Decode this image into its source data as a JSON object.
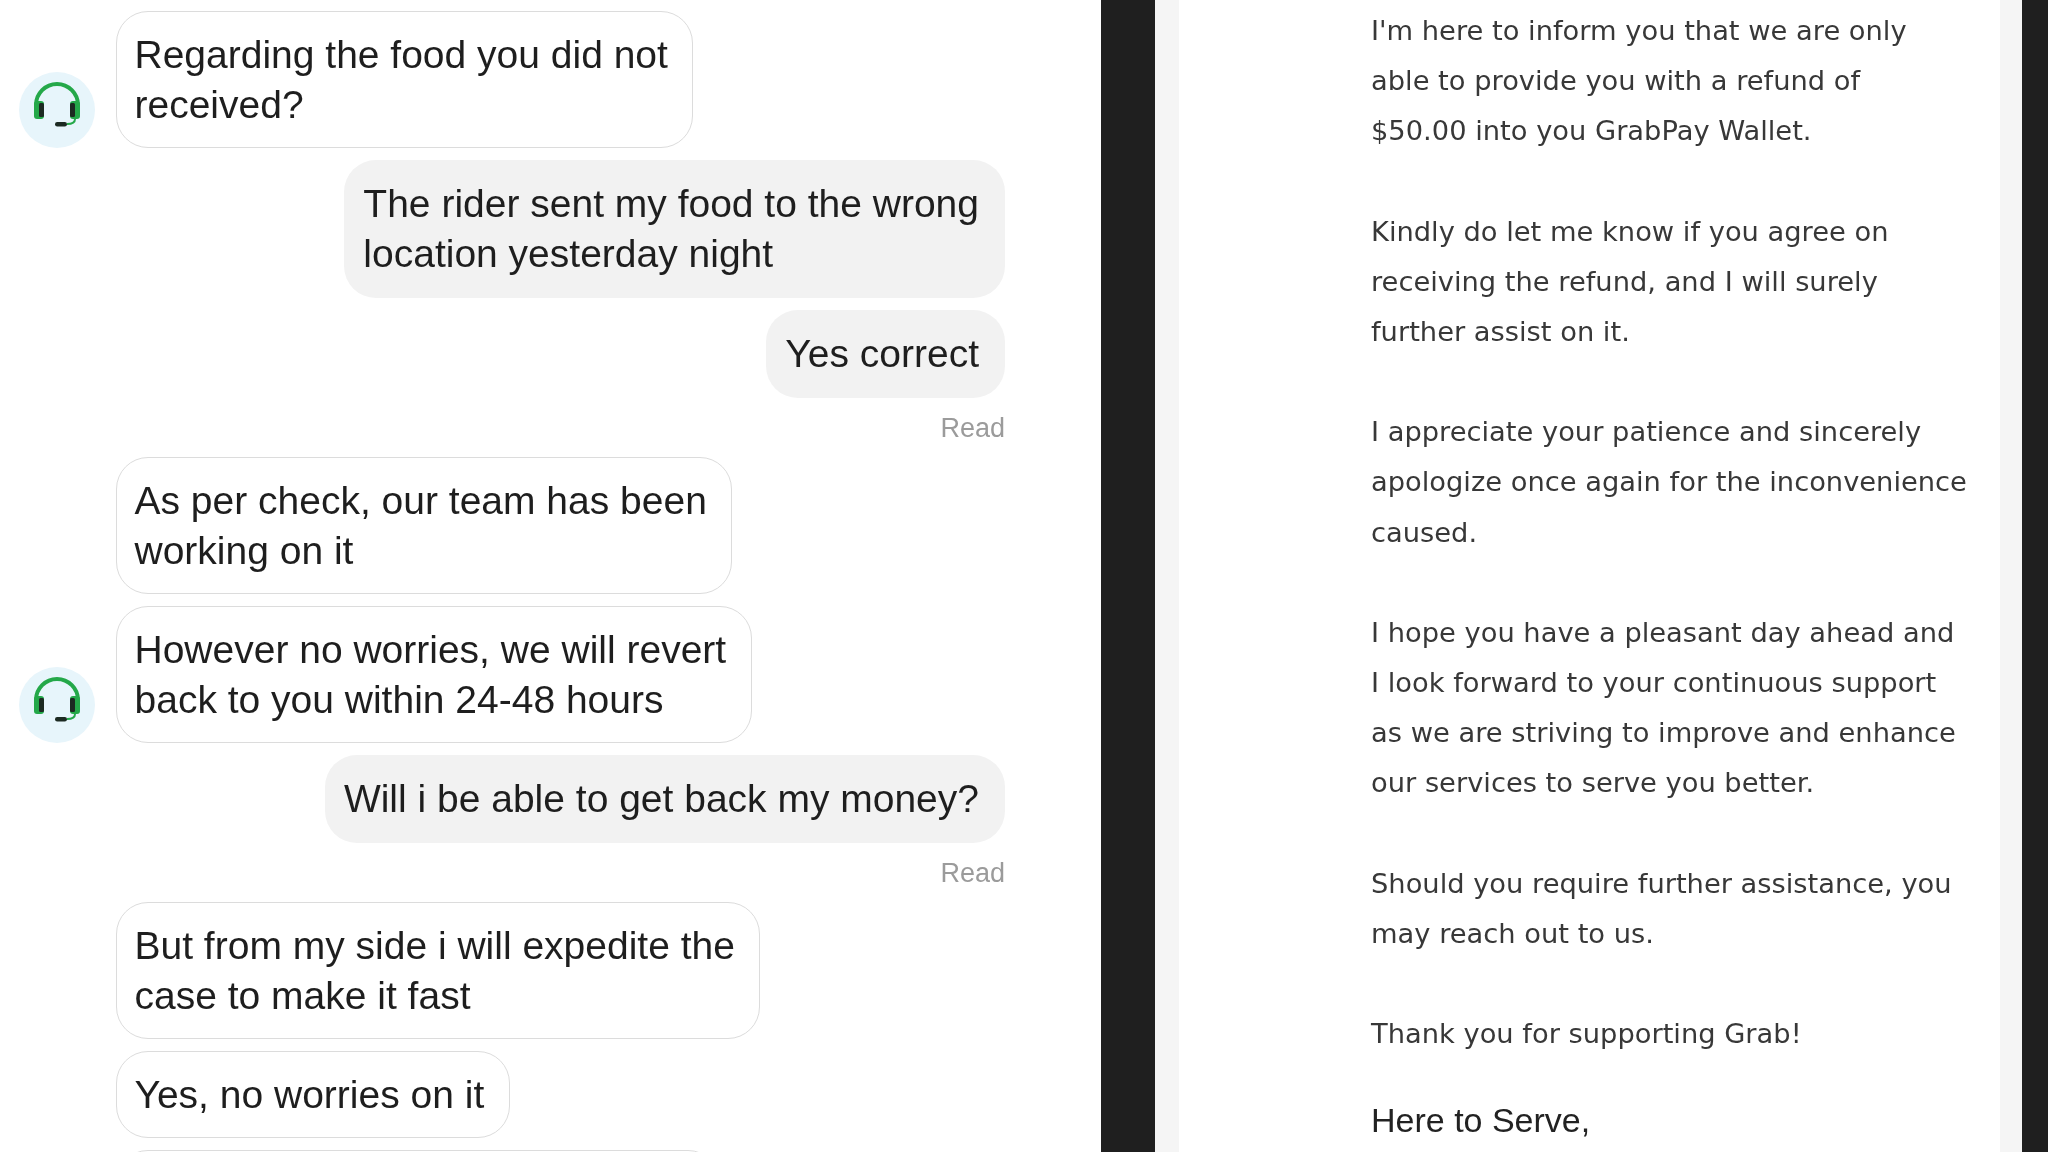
{
  "chat": {
    "messages": [
      {
        "kind": "incoming",
        "avatar": true,
        "text": "Regarding the food you did not\nreceived?"
      },
      {
        "kind": "outgoing",
        "avatar": false,
        "text": "The rider sent my food to the wrong\nlocation yesterday night"
      },
      {
        "kind": "outgoing",
        "avatar": false,
        "text": "Yes correct",
        "receipt": "Read"
      },
      {
        "kind": "incoming",
        "avatar": false,
        "text": "As per check, our team has been\nworking on it"
      },
      {
        "kind": "incoming",
        "avatar": true,
        "text": "However no worries, we will revert\nback to you within 24-48 hours"
      },
      {
        "kind": "outgoing",
        "avatar": false,
        "text": "Will i be able to get back my money?",
        "receipt": "Read"
      },
      {
        "kind": "incoming",
        "avatar": false,
        "text": "But from my side i will expedite the\ncase to make it fast"
      },
      {
        "kind": "incoming",
        "avatar": false,
        "text": "Yes, no worries on it"
      },
      {
        "kind": "incoming",
        "avatar": false
      }
    ]
  },
  "email": {
    "paragraphs": [
      "I'm here to inform you that we are only\nable to provide you with a refund of\n$50.00 into you GrabPay Wallet.",
      "Kindly do let me know if you agree on\nreceiving the refund, and I will surely\nfurther assist on it.",
      "I appreciate your patience and sincerely\napologize once again for the inconvenience\ncaused.",
      "I hope you have a pleasant day ahead and\nI look forward to your continuous support\nas we are striving to improve and enhance\nour services to serve you better.",
      "Should you require further assistance, you\nmay reach out to us.",
      "Thank you for supporting Grab!"
    ],
    "signoff": "Here to Serve,"
  }
}
